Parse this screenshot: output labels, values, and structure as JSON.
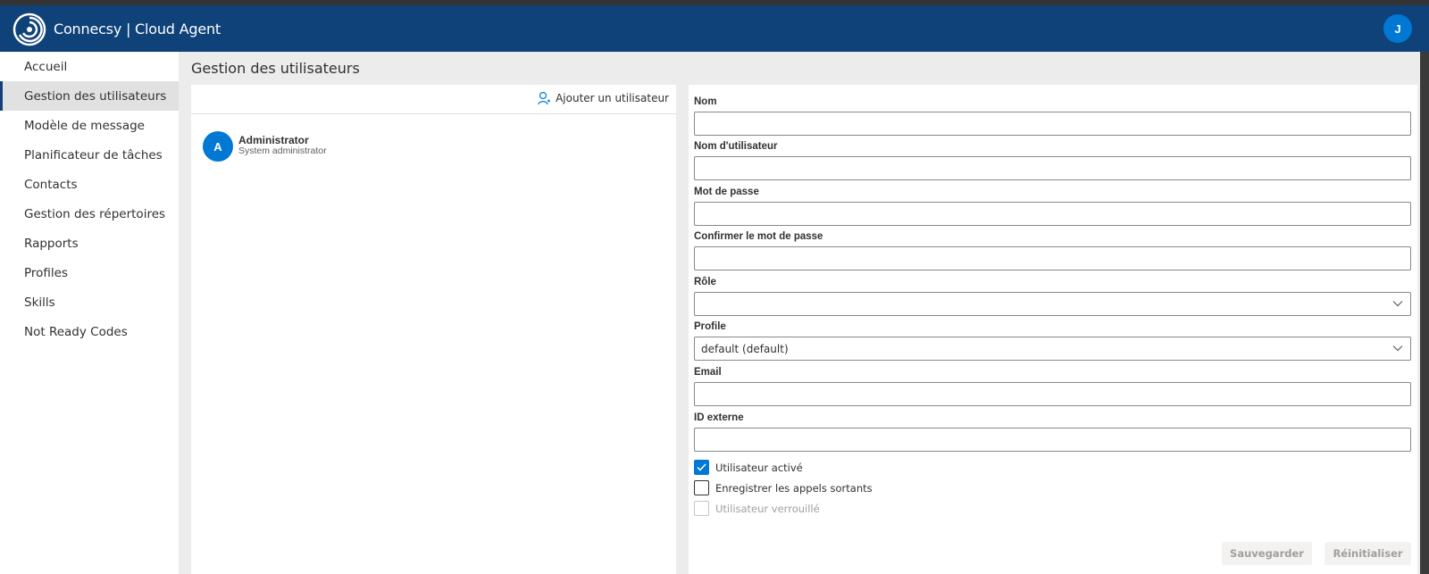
{
  "app": {
    "title": "Connecsy | Cloud Agent",
    "user_initial": "J",
    "brand_color": "#0f4279",
    "accent_color": "#0078d4"
  },
  "sidebar": {
    "items": [
      {
        "label": "Accueil",
        "active": false
      },
      {
        "label": "Gestion des utilisateurs",
        "active": true
      },
      {
        "label": "Modèle de message",
        "active": false
      },
      {
        "label": "Planificateur de tâches",
        "active": false
      },
      {
        "label": "Contacts",
        "active": false
      },
      {
        "label": "Gestion des répertoires",
        "active": false
      },
      {
        "label": "Rapports",
        "active": false
      },
      {
        "label": "Profiles",
        "active": false
      },
      {
        "label": "Skills",
        "active": false
      },
      {
        "label": "Not Ready Codes",
        "active": false
      }
    ]
  },
  "page": {
    "title": "Gestion des utilisateurs"
  },
  "user_list": {
    "add_label": "Ajouter un utilisateur",
    "users": [
      {
        "initial": "A",
        "name": "Administrator",
        "description": "System administrator"
      }
    ]
  },
  "form": {
    "fields": {
      "name": {
        "label": "Nom",
        "value": ""
      },
      "username": {
        "label": "Nom d'utilisateur",
        "value": ""
      },
      "password": {
        "label": "Mot de passe",
        "value": ""
      },
      "confirm_password": {
        "label": "Confirmer le mot de passe",
        "value": ""
      },
      "role": {
        "label": "Rôle",
        "value": ""
      },
      "profile": {
        "label": "Profile",
        "value": "default (default)"
      },
      "email": {
        "label": "Email",
        "value": ""
      },
      "external_id": {
        "label": "ID externe",
        "value": ""
      }
    },
    "checkboxes": {
      "active": {
        "label": "Utilisateur activé",
        "checked": true
      },
      "record_outgoing": {
        "label": "Enregistrer les appels sortants",
        "checked": false
      },
      "locked": {
        "label": "Utilisateur verrouillé",
        "checked": false,
        "disabled": true
      }
    },
    "buttons": {
      "save": "Sauvegarder",
      "reset": "Réinitialiser"
    }
  }
}
